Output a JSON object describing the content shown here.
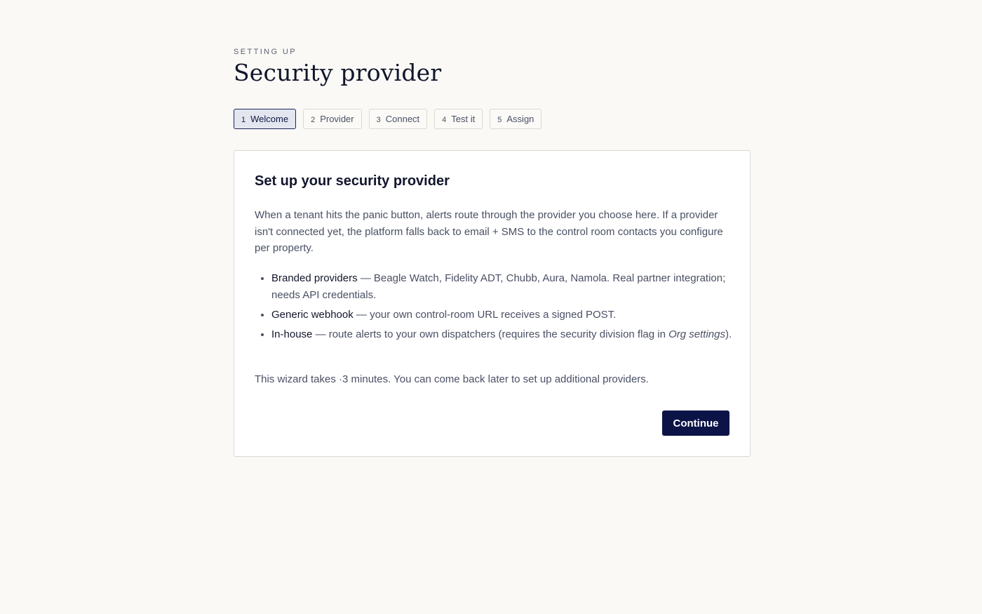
{
  "header": {
    "eyebrow": "SETTING UP",
    "title": "Security provider"
  },
  "steps": [
    {
      "num": "1",
      "label": "Welcome",
      "active": true
    },
    {
      "num": "2",
      "label": "Provider",
      "active": false
    },
    {
      "num": "3",
      "label": "Connect",
      "active": false
    },
    {
      "num": "4",
      "label": "Test it",
      "active": false
    },
    {
      "num": "5",
      "label": "Assign",
      "active": false
    }
  ],
  "card": {
    "title": "Set up your security provider",
    "intro": "When a tenant hits the panic button, alerts route through the provider you choose here. If a provider isn't connected yet, the platform falls back to email + SMS to the control room contacts you configure per property.",
    "bullets": [
      {
        "term": "Branded providers",
        "sep": " — ",
        "text": "Beagle Watch, Fidelity ADT, Chubb, Aura, Namola. Real partner integration; needs API credentials."
      },
      {
        "term": "Generic webhook",
        "sep": " — ",
        "text": "your own control-room URL receives a signed POST."
      },
      {
        "term": "In-house",
        "sep": " — ",
        "text_before": "route alerts to your own dispatchers (requires the security division flag in ",
        "emphasis": "Org settings",
        "text_after": ")."
      }
    ],
    "footnote": "This wizard takes ·3 minutes. You can come back later to set up additional providers.",
    "continue_label": "Continue"
  },
  "colors": {
    "background": "#faf9f6",
    "accent": "#0c1447",
    "active_step_bg": "#e3e6ef"
  }
}
